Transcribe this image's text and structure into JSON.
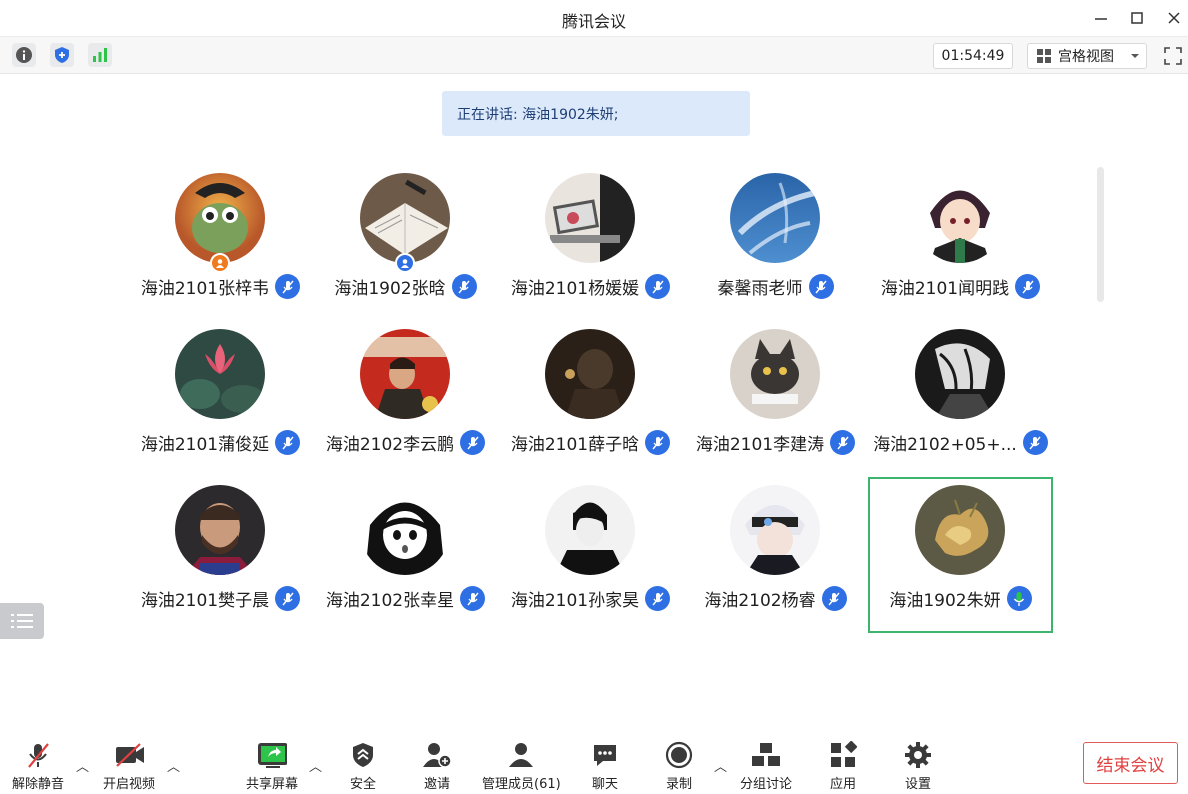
{
  "window": {
    "title": "腾讯会议"
  },
  "toolbar": {
    "timer": "01:54:49",
    "view_label": "宫格视图"
  },
  "speaking_banner": "正在讲话: 海油1902朱妍;",
  "participants": [
    {
      "name": "海油2101张梓韦",
      "badge": "orange",
      "mic": "blue"
    },
    {
      "name": "海油1902张晗",
      "badge": "blue",
      "mic": "blue"
    },
    {
      "name": "海油2101杨媛媛",
      "mic": "blue"
    },
    {
      "name": "秦馨雨老师",
      "mic": "blue"
    },
    {
      "name": "海油2101闻明践",
      "mic": "blue"
    },
    {
      "name": "海油2101蒲俊延",
      "mic": "blue"
    },
    {
      "name": "海油2102李云鹏",
      "mic": "blue"
    },
    {
      "name": "海油2101薛子晗",
      "mic": "blue"
    },
    {
      "name": "海油2101李建涛",
      "mic": "blue"
    },
    {
      "name": "海油2102+05+...",
      "mic": "blue"
    },
    {
      "name": "海油2101樊子晨",
      "mic": "blue"
    },
    {
      "name": "海油2102张幸星",
      "mic": "blue"
    },
    {
      "name": "海油2101孙家昊",
      "mic": "blue"
    },
    {
      "name": "海油2102杨睿",
      "mic": "blue"
    },
    {
      "name": "海油1902朱妍",
      "mic": "speaking",
      "active": true
    }
  ],
  "bottom": {
    "unmute": "解除静音",
    "video": "开启视频",
    "share": "共享屏幕",
    "security": "安全",
    "invite": "邀请",
    "members": "管理成员(61)",
    "chat": "聊天",
    "record": "录制",
    "breakout": "分组讨论",
    "apps": "应用",
    "settings": "设置",
    "end": "结束会议"
  },
  "colors": {
    "accent": "#2f6fe4",
    "active_border": "#3cb46e",
    "speaking_mic": "#2ec44a",
    "end_red": "#e0403f",
    "banner_bg": "#dce9fb"
  }
}
